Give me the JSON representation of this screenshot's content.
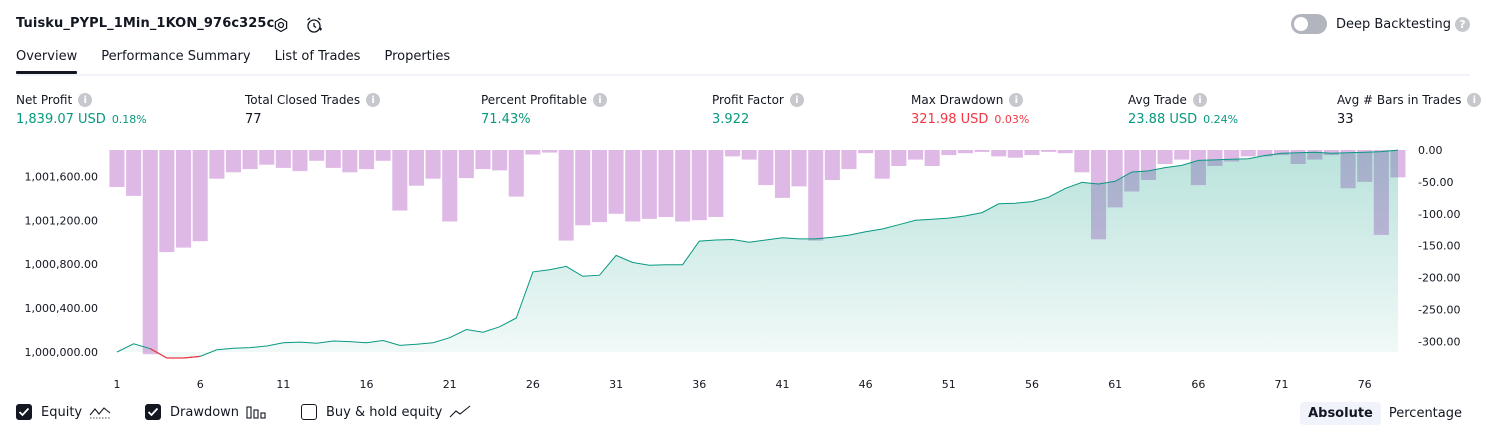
{
  "header": {
    "title": "Tuisku_PYPL_1Min_1KON_976c325c",
    "deep_backtesting_label": "Deep Backtesting",
    "deep_backtesting_on": false
  },
  "tabs": [
    "Overview",
    "Performance Summary",
    "List of Trades",
    "Properties"
  ],
  "active_tab": "Overview",
  "metrics": [
    {
      "label": "Net Profit",
      "value": "1,839.07 USD",
      "pct": "0.18%",
      "color": "#089981"
    },
    {
      "label": "Total Closed Trades",
      "value": "77",
      "pct": "",
      "color": "#131722"
    },
    {
      "label": "Percent Profitable",
      "value": "71.43%",
      "pct": "",
      "color": "#089981"
    },
    {
      "label": "Profit Factor",
      "value": "3.922",
      "pct": "",
      "color": "#089981"
    },
    {
      "label": "Max Drawdown",
      "value": "321.98 USD",
      "pct": "0.03%",
      "color": "#f23645"
    },
    {
      "label": "Avg Trade",
      "value": "23.88 USD",
      "pct": "0.24%",
      "color": "#089981"
    },
    {
      "label": "Avg # Bars in Trades",
      "value": "33",
      "pct": "",
      "color": "#131722"
    }
  ],
  "chart_data": {
    "type": "line",
    "x": [
      1,
      2,
      3,
      4,
      5,
      6,
      7,
      8,
      9,
      10,
      11,
      12,
      13,
      14,
      15,
      16,
      17,
      18,
      19,
      20,
      21,
      22,
      23,
      24,
      25,
      26,
      27,
      28,
      29,
      30,
      31,
      32,
      33,
      34,
      35,
      36,
      37,
      38,
      39,
      40,
      41,
      42,
      43,
      44,
      45,
      46,
      47,
      48,
      49,
      50,
      51,
      52,
      53,
      54,
      55,
      56,
      57,
      58,
      59,
      60,
      61,
      62,
      63,
      64,
      65,
      66,
      67,
      68,
      69,
      70,
      71,
      72,
      73,
      74,
      75,
      76,
      77,
      78
    ],
    "xticks": [
      "1",
      "6",
      "11",
      "16",
      "21",
      "26",
      "31",
      "36",
      "41",
      "46",
      "51",
      "56",
      "61",
      "66",
      "71",
      "76"
    ],
    "yticks_left": [
      "1,000,000.00",
      "1,000,400.00",
      "1,000,800.00",
      "1,001,200.00",
      "1,001,600.00"
    ],
    "yticks_right": [
      "0.00",
      "-50.00",
      "-100.00",
      "-150.00",
      "-200.00",
      "-250.00",
      "-300.00"
    ],
    "ylim_left": [
      1000000,
      1001840
    ],
    "ylim_right": [
      -315,
      0
    ],
    "series": [
      {
        "name": "Equity",
        "color": "#089981",
        "values": [
          1000000,
          1000075,
          1000030,
          999900,
          999920,
          999960,
          1000020,
          1000035,
          1000040,
          1000055,
          1000085,
          1000090,
          1000080,
          1000100,
          1000095,
          1000085,
          1000105,
          1000060,
          1000070,
          1000085,
          1000130,
          1000205,
          1000180,
          1000230,
          1000310,
          1000730,
          1000750,
          1000780,
          1000690,
          1000700,
          1000880,
          1000815,
          1000790,
          1000795,
          1000795,
          1001010,
          1001020,
          1001025,
          1001000,
          1001020,
          1001040,
          1001030,
          1001030,
          1001045,
          1001065,
          1001095,
          1001120,
          1001160,
          1001200,
          1001210,
          1001220,
          1001240,
          1001270,
          1001350,
          1001355,
          1001370,
          1001410,
          1001490,
          1001545,
          1001530,
          1001555,
          1001640,
          1001650,
          1001680,
          1001700,
          1001745,
          1001750,
          1001755,
          1001760,
          1001790,
          1001810,
          1001815,
          1001820,
          1001810,
          1001815,
          1001820,
          1001825,
          1001839.07
        ]
      },
      {
        "name": "Drawdown",
        "color": "#ce93d8",
        "values": [
          -58,
          -72,
          -320,
          -160,
          -153,
          -143,
          -45,
          -35,
          -30,
          -23,
          -28,
          -33,
          -17,
          -28,
          -35,
          -30,
          -17,
          -95,
          -56,
          -45,
          -112,
          -44,
          -30,
          -32,
          -73,
          -7,
          -4,
          -142,
          -118,
          -113,
          -100,
          -112,
          -108,
          -105,
          -112,
          -110,
          -105,
          -10,
          -15,
          -55,
          -75,
          -57,
          -142,
          -47,
          -30,
          -5,
          -45,
          -25,
          -15,
          -25,
          -8,
          -5,
          -3,
          -10,
          -12,
          -8,
          -3,
          -5,
          -35,
          -140,
          -90,
          -65,
          -47,
          -22,
          -15,
          -55,
          -25,
          -18,
          -10,
          -10,
          -8,
          -22,
          -15,
          -8,
          -60,
          -50,
          -133,
          -43
        ]
      }
    ],
    "legend": [
      "Equity",
      "Drawdown",
      "Buy & hold equity"
    ]
  },
  "footer": {
    "equity_label": "Equity",
    "drawdown_label": "Drawdown",
    "buyhold_label": "Buy & hold equity",
    "equity_checked": true,
    "drawdown_checked": true,
    "buyhold_checked": false,
    "absolute_label": "Absolute",
    "percentage_label": "Percentage"
  }
}
